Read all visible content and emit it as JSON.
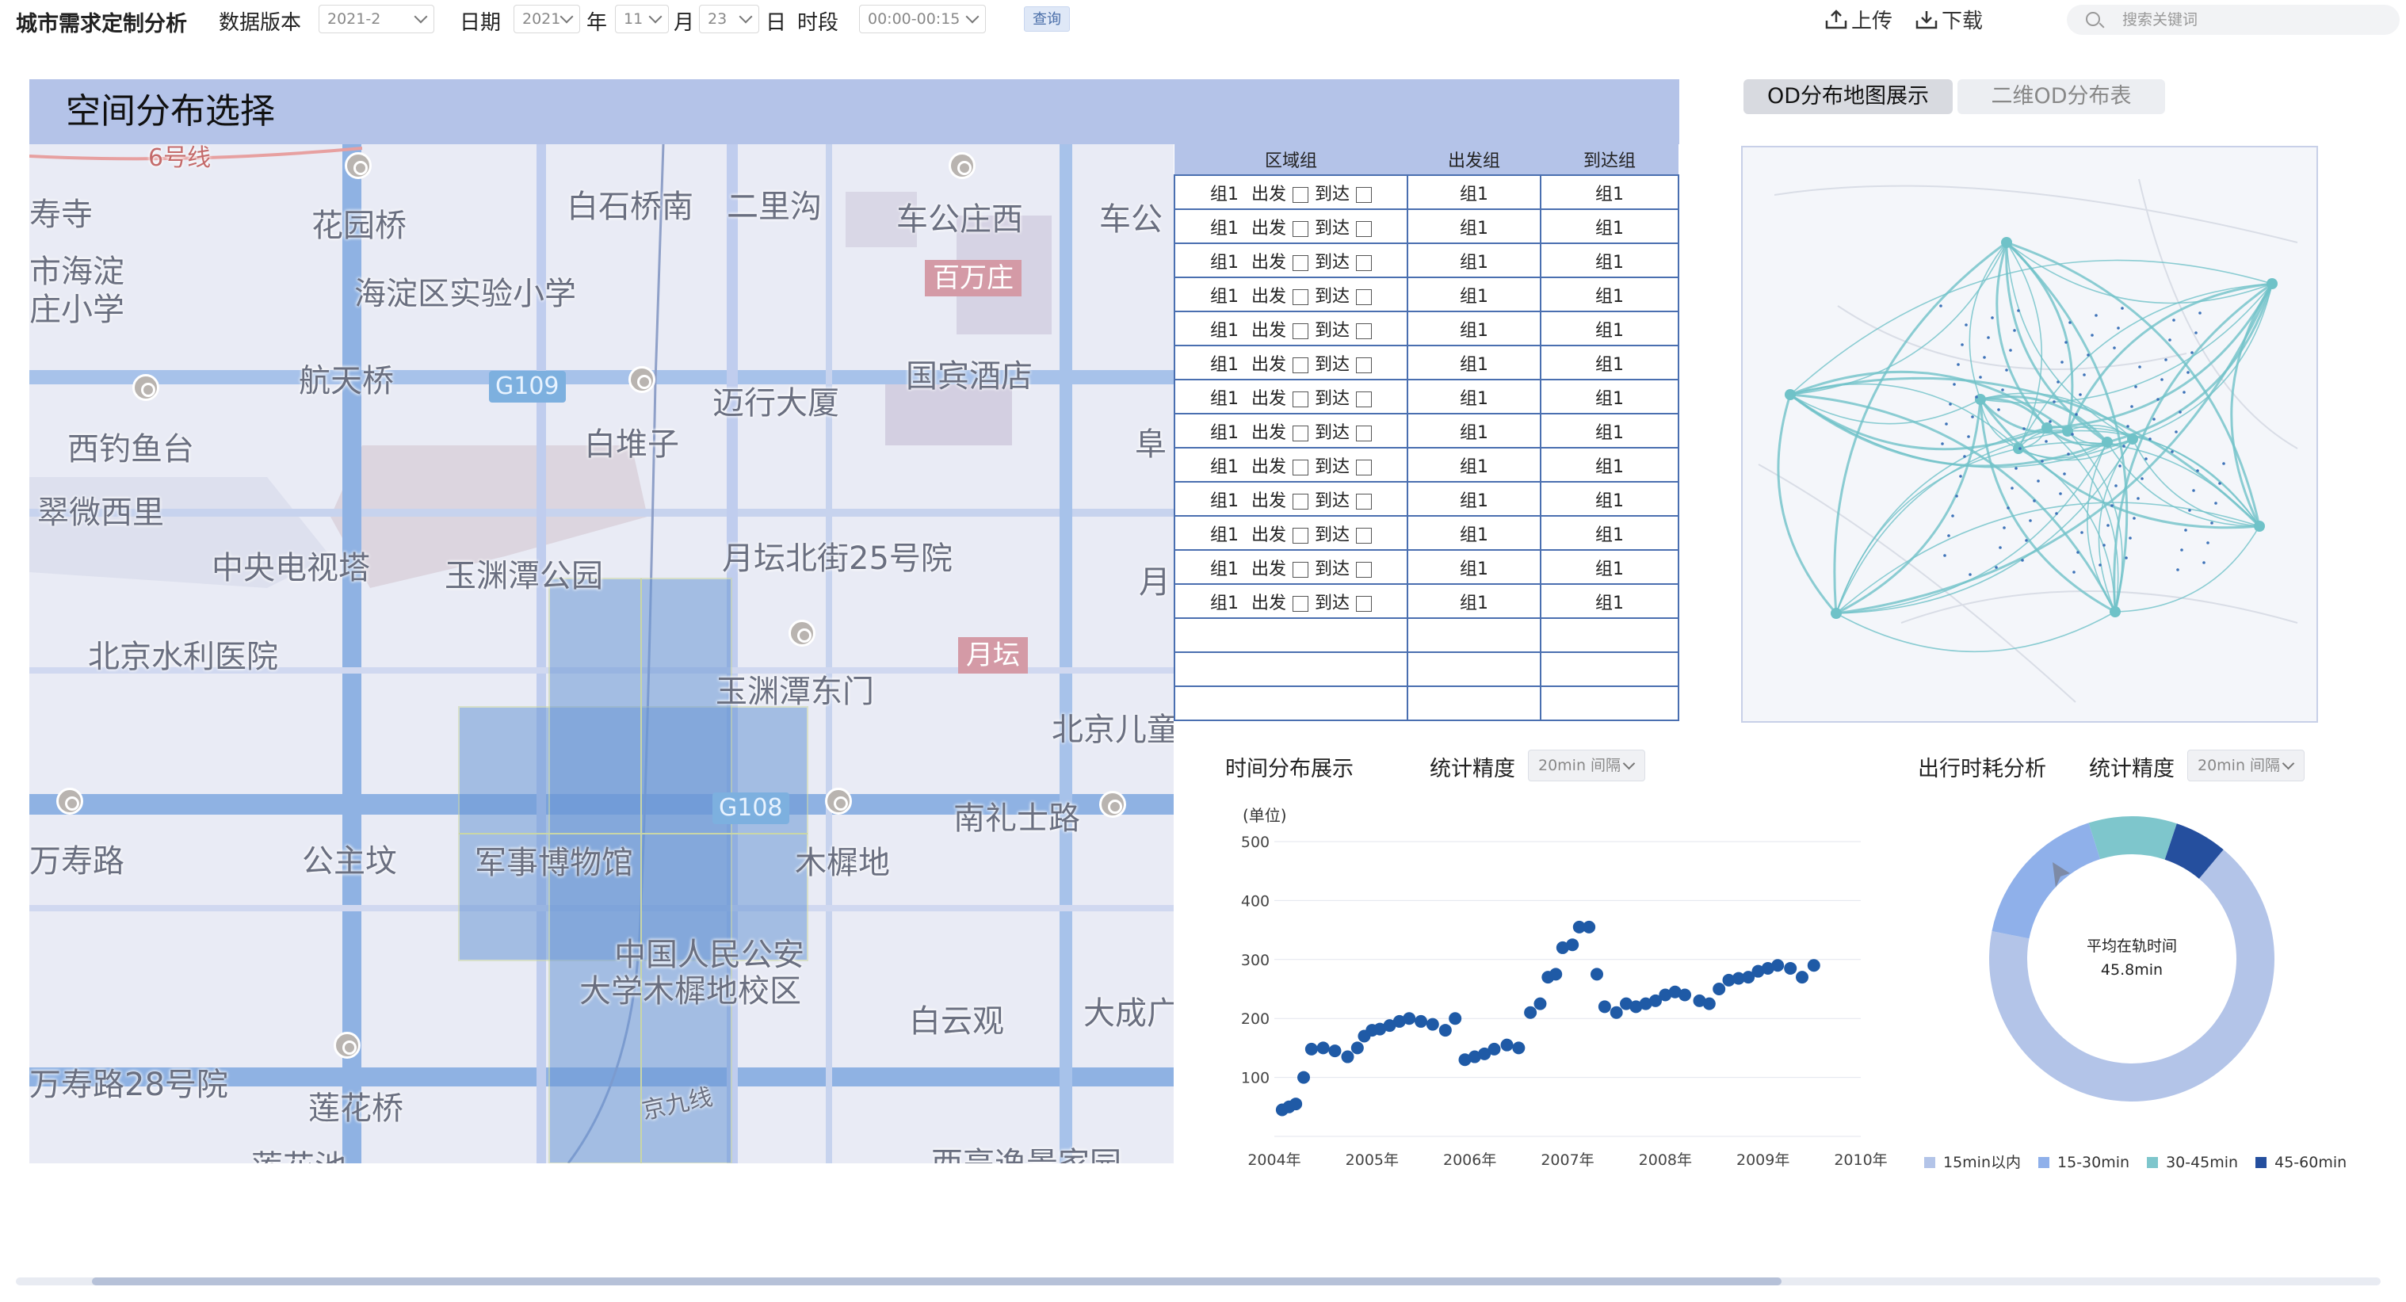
{
  "toolbar": {
    "app_title": "城市需求定制分析",
    "data_version_label": "数据版本",
    "data_version_value": "2021-2",
    "date_label": "日期",
    "year_value": "2021",
    "year_unit": "年",
    "month_value": "11",
    "month_unit": "月",
    "day_value": "23",
    "day_unit": "日",
    "period_label": "时段",
    "period_value": "00:00-00:15",
    "query_label": "查询",
    "upload_label": "上传",
    "download_label": "下载",
    "search_placeholder": "搜索关键词"
  },
  "spatial": {
    "title": "空间分布选择",
    "map_labels": [
      "6号线",
      "寿寺",
      "花园桥",
      "白石桥南",
      "二里沟",
      "车公庄西",
      "车公",
      "市海淀",
      "庄小学",
      "海淀区实验小学",
      "百万庄",
      "航天桥",
      "G109",
      "迈行大厦",
      "国宾酒店",
      "西钓鱼台",
      "白堆子",
      "阜",
      "翠微西里",
      "中央电视塔",
      "玉渊潭公园",
      "月坛北街25号院",
      "月",
      "北京水利医院",
      "月坛",
      "玉渊潭东门",
      "北京儿童",
      "万寿路",
      "公主坟",
      "军事博物馆",
      "G108",
      "木樨地",
      "南礼士路",
      "中国人民公安",
      "大学木樨地校区",
      "白云观",
      "大成广",
      "万寿路28号院",
      "莲花桥",
      "京九线",
      "莲花池",
      "西亭逸景家园"
    ]
  },
  "group_table": {
    "headers": [
      "区域组",
      "出发组",
      "到达组"
    ],
    "row_group": "组1",
    "depart_label": "出发",
    "arrive_label": "到达",
    "rows": [
      {
        "group": "组1",
        "depart": "组1",
        "arrive": "组1"
      },
      {
        "group": "组1",
        "depart": "组1",
        "arrive": "组1"
      },
      {
        "group": "组1",
        "depart": "组1",
        "arrive": "组1"
      },
      {
        "group": "组1",
        "depart": "组1",
        "arrive": "组1"
      },
      {
        "group": "组1",
        "depart": "组1",
        "arrive": "组1"
      },
      {
        "group": "组1",
        "depart": "组1",
        "arrive": "组1"
      },
      {
        "group": "组1",
        "depart": "组1",
        "arrive": "组1"
      },
      {
        "group": "组1",
        "depart": "组1",
        "arrive": "组1"
      },
      {
        "group": "组1",
        "depart": "组1",
        "arrive": "组1"
      },
      {
        "group": "组1",
        "depart": "组1",
        "arrive": "组1"
      },
      {
        "group": "组1",
        "depart": "组1",
        "arrive": "组1"
      },
      {
        "group": "组1",
        "depart": "组1",
        "arrive": "组1"
      },
      {
        "group": "组1",
        "depart": "组1",
        "arrive": "组1"
      }
    ],
    "empty_rows": 3
  },
  "od": {
    "tab_map": "OD分布地图展示",
    "tab_table": "二维OD分布表"
  },
  "time_dist": {
    "title": "时间分布展示",
    "precision_label": "统计精度",
    "precision_value": "20min 间隔"
  },
  "travel": {
    "title": "出行时耗分析",
    "precision_label": "统计精度",
    "precision_value": "20min 间隔",
    "center_label": "平均在轨时间",
    "center_value": "45.8min"
  },
  "colors": {
    "accent": "#b4c3e8",
    "scatter_dot": "#1f5aa6",
    "od_line": "#6fc2c8",
    "donut": [
      "#b3c4e8",
      "#8fb0ea",
      "#7ec6cc",
      "#254f9e"
    ]
  },
  "chart_data": [
    {
      "type": "scatter",
      "ylabel": "(单位)",
      "ylim": [
        0,
        500
      ],
      "yticks": [
        100,
        200,
        300,
        400,
        500
      ],
      "x_tick_labels": [
        "2004年",
        "2005年",
        "2006年",
        "2007年",
        "2008年",
        "2009年",
        "2010年"
      ],
      "x_range": [
        2004.0,
        2010.0
      ],
      "grid": "horizontal",
      "points": [
        [
          2004.08,
          45
        ],
        [
          2004.15,
          50
        ],
        [
          2004.22,
          55
        ],
        [
          2004.3,
          100
        ],
        [
          2004.38,
          148
        ],
        [
          2004.5,
          150
        ],
        [
          2004.62,
          145
        ],
        [
          2004.75,
          135
        ],
        [
          2004.85,
          150
        ],
        [
          2004.92,
          170
        ],
        [
          2005.0,
          180
        ],
        [
          2005.08,
          182
        ],
        [
          2005.18,
          188
        ],
        [
          2005.28,
          195
        ],
        [
          2005.38,
          200
        ],
        [
          2005.5,
          195
        ],
        [
          2005.62,
          190
        ],
        [
          2005.75,
          180
        ],
        [
          2005.85,
          200
        ],
        [
          2005.95,
          130
        ],
        [
          2006.05,
          135
        ],
        [
          2006.15,
          140
        ],
        [
          2006.25,
          148
        ],
        [
          2006.38,
          155
        ],
        [
          2006.5,
          150
        ],
        [
          2006.62,
          210
        ],
        [
          2006.72,
          225
        ],
        [
          2006.8,
          270
        ],
        [
          2006.88,
          275
        ],
        [
          2006.95,
          320
        ],
        [
          2007.05,
          325
        ],
        [
          2007.12,
          355
        ],
        [
          2007.22,
          355
        ],
        [
          2007.3,
          275
        ],
        [
          2007.38,
          220
        ],
        [
          2007.5,
          210
        ],
        [
          2007.6,
          225
        ],
        [
          2007.7,
          220
        ],
        [
          2007.8,
          225
        ],
        [
          2007.9,
          230
        ],
        [
          2008.0,
          240
        ],
        [
          2008.1,
          245
        ],
        [
          2008.2,
          240
        ],
        [
          2008.35,
          230
        ],
        [
          2008.45,
          225
        ],
        [
          2008.55,
          250
        ],
        [
          2008.65,
          265
        ],
        [
          2008.75,
          268
        ],
        [
          2008.85,
          270
        ],
        [
          2008.95,
          280
        ],
        [
          2009.05,
          285
        ],
        [
          2009.15,
          290
        ],
        [
          2009.28,
          285
        ],
        [
          2009.4,
          270
        ],
        [
          2009.52,
          290
        ]
      ]
    },
    {
      "type": "pie",
      "title": "平均在轨时间",
      "categories": [
        "15min以内",
        "15-30min",
        "30-45min",
        "45-60min"
      ],
      "values": [
        67,
        17,
        10,
        6
      ],
      "donut": true
    }
  ]
}
